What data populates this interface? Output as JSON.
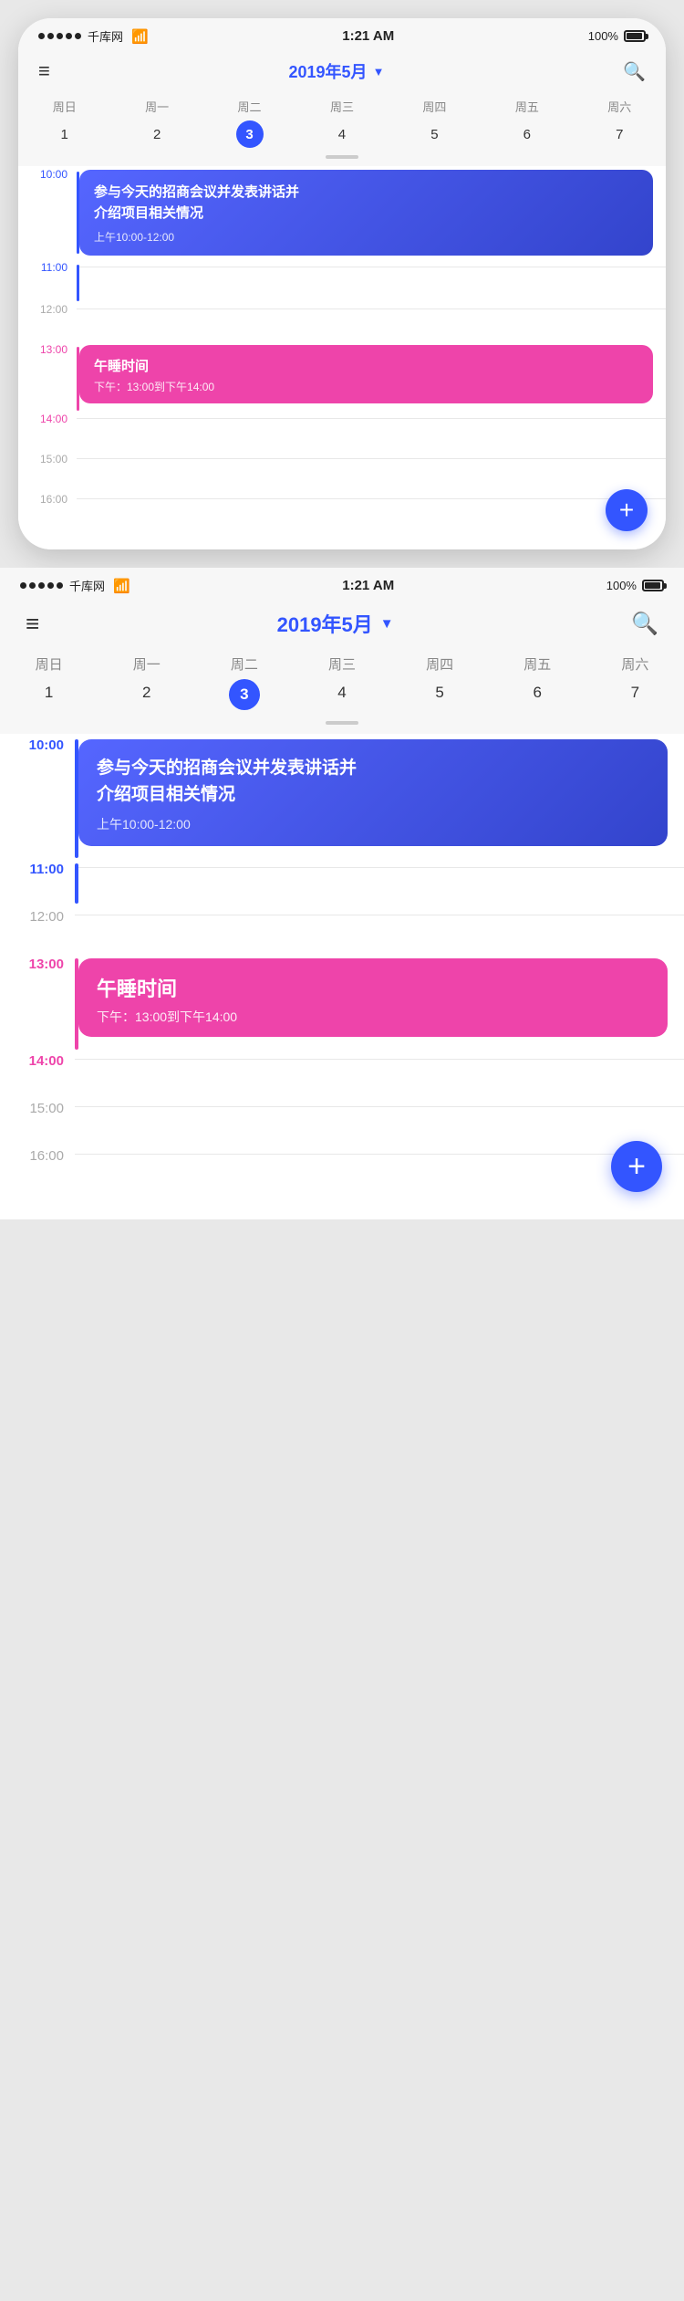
{
  "app": {
    "statusBar": {
      "carrier": "千库网",
      "time": "1:21 AM",
      "battery": "100%"
    },
    "header": {
      "title": "2019年5月",
      "dropdownArrow": "▼",
      "menuIcon": "≡",
      "searchIcon": "🔍"
    },
    "weekdays": [
      {
        "label": "周日",
        "num": "1",
        "active": false
      },
      {
        "label": "周一",
        "num": "2",
        "active": false
      },
      {
        "label": "周二",
        "num": "3",
        "active": true
      },
      {
        "label": "周三",
        "num": "4",
        "active": false
      },
      {
        "label": "周四",
        "num": "5",
        "active": false
      },
      {
        "label": "周五",
        "num": "6",
        "active": false
      },
      {
        "label": "周六",
        "num": "7",
        "active": false
      }
    ],
    "timeline": {
      "times": [
        "10:00",
        "11:00",
        "12:00",
        "13:00",
        "14:00",
        "15:00",
        "16:00"
      ]
    },
    "events": [
      {
        "id": "event1",
        "title": "参与今天的招商会议并发表讲话并介绍项目相关情况",
        "time": "上午10:00-12:00",
        "color": "blue",
        "startHour": "10:00",
        "endHour": "11:00"
      },
      {
        "id": "event2",
        "title": "午睡时间",
        "time": "下午：13:00到下午14:00",
        "color": "pink",
        "startHour": "13:00",
        "endHour": "14:00"
      }
    ],
    "fab": "+",
    "colors": {
      "blue": "#3355ff",
      "pink": "#ee44aa",
      "accent": "#3355ff"
    }
  }
}
